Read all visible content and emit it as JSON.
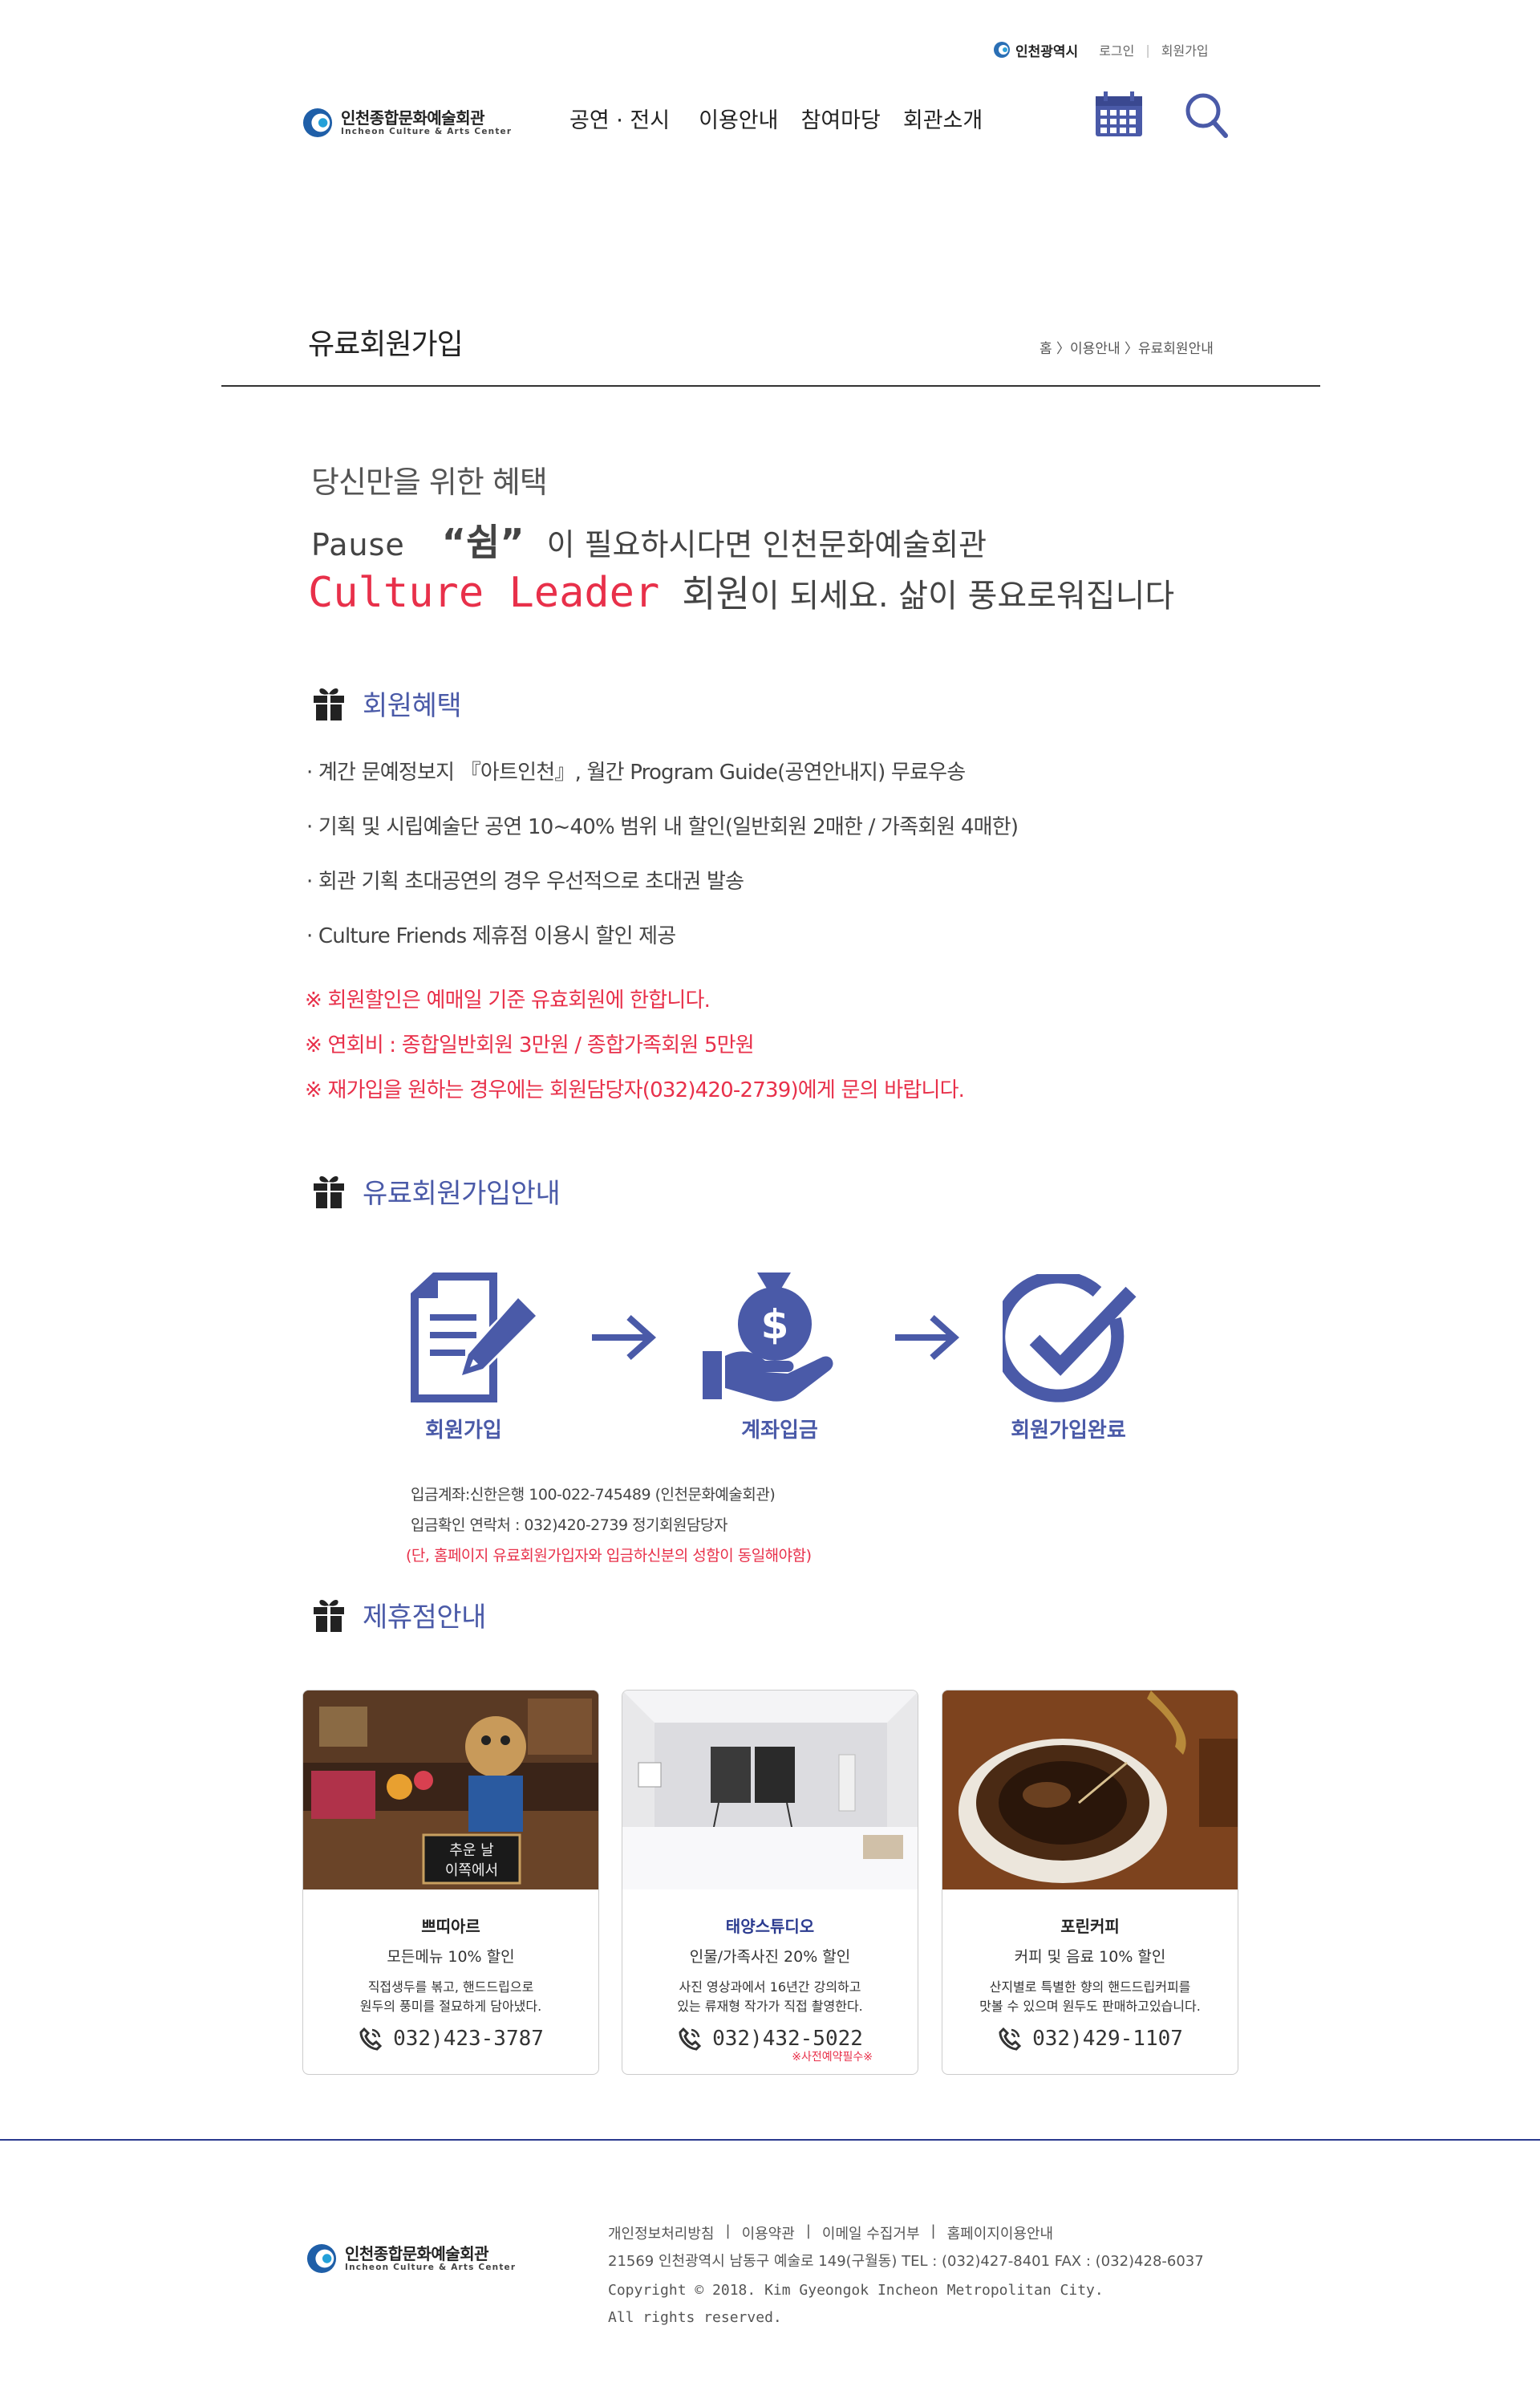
{
  "utility": {
    "city": "인천광역시",
    "login": "로그인",
    "divider": "|",
    "join": "회원가입"
  },
  "logo": {
    "korean": "인천종합문화예술회관",
    "english": "Incheon Culture & Arts Center"
  },
  "gnb": [
    "공연 · 전시",
    "이용안내",
    "참여마당",
    "회관소개"
  ],
  "page": {
    "title": "유료회원가입",
    "breadcrumb": "홈 〉이용안내 〉유료회원안내"
  },
  "intro": {
    "line1": "당신만을 위한 혜택",
    "pause": "Pause",
    "swim": "“쉼”",
    "line2_rest": "이 필요하시다면 인천문화예술회관",
    "culture_leader": "Culture Leader",
    "member_word": "회원",
    "line3_rest": "이 되세요. 삶이 풍요로워집니다"
  },
  "benefits_section": {
    "title": "회원혜택",
    "items": [
      "· 계간 문예정보지 『아트인천』, 월간 Program Guide(공연안내지) 무료우송",
      "· 기획 및 시립예술단 공연 10~40% 범위 내 할인(일반회원 2매한 / 가족회원 4매한)",
      "· 회관 기획 초대공연의 경우 우선적으로 초대권 발송",
      "· Culture Friends 제휴점 이용시 할인 제공"
    ],
    "notices": [
      "※ 회원할인은 예매일 기준 유효회원에 한합니다.",
      "※ 연회비 : 종합일반회원 3만원 / 종합가족회원 5만원",
      "※ 재가입을 원하는 경우에는 회원담당자(032)420-2739)에게 문의 바랍니다."
    ]
  },
  "join_section": {
    "title": "유료회원가입안내",
    "steps": [
      "회원가입",
      "계좌입금",
      "회원가입완료"
    ],
    "account": "입금계좌:신한은행 100-022-745489 (인천문화예술회관)",
    "contact": "입금확인 연락처 : 032)420-2739 정기회원담당자",
    "warning": "(단, 홈페이지 유료회원가입자와 입금하신분의 성함이 동일해야함)"
  },
  "partner_section": {
    "title": "제휴점안내",
    "cards": [
      {
        "name": "쁘띠아르",
        "name_color": "#222222",
        "discount": "모든메뉴 10% 할인",
        "desc1": "직접생두를 볶고, 핸드드립으로",
        "desc2": "원두의 풍미를 절묘하게 담아냈다.",
        "phone": "032)423-3787",
        "sign1": "추운 날",
        "sign2": "이쪽에서"
      },
      {
        "name": "태양스튜디오",
        "name_color": "#2a3a8f",
        "discount": "인물/가족사진 20% 할인",
        "desc1": "사진 영상과에서 16년간 강의하고",
        "desc2": "있는 류재형 작가가 직접 촬영한다.",
        "phone": "032)432-5022",
        "note": "※사전예약필수※"
      },
      {
        "name": "포린커피",
        "name_color": "#222222",
        "discount": "커피 및 음료 10% 할인",
        "desc1": "산지별로 특별한 향의 핸드드립커피를",
        "desc2": "맛볼 수 있으며 원두도 판매하고있습니다.",
        "phone": "032)429-1107"
      }
    ]
  },
  "footer": {
    "links": [
      "개인정보처리방침",
      "|",
      "이용약관",
      "|",
      "이메일 수집거부",
      "|",
      "홈페이지이용안내"
    ],
    "address": "21569 인천광역시 남동구 예술로 149(구월동) TEL : (032)427-8401 FAX : (032)428-6037",
    "copyright": "Copyright © 2018. Kim Gyeongok Incheon Metropolitan City.",
    "rights": "All rights reserved."
  },
  "colors": {
    "brand_blue": "#4a5aa8",
    "footer_line": "#2a3a8f",
    "accent_red": "#e8304a"
  },
  "icons": [
    "city-logo-icon",
    "calendar-icon",
    "search-icon",
    "gift-icon",
    "document-edit-icon",
    "money-hand-icon",
    "check-circle-icon",
    "arrow-right-icon",
    "phone-icon"
  ]
}
